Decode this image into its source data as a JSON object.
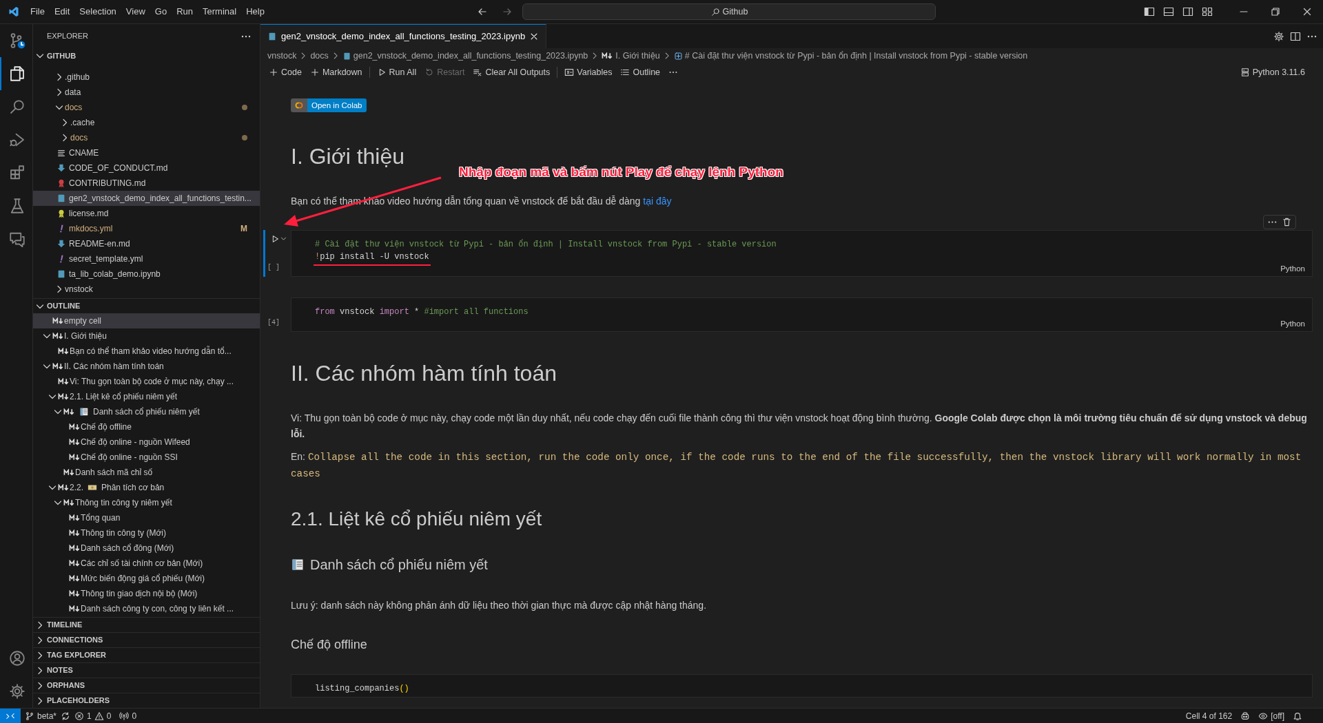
{
  "title_bar": {
    "menu": [
      "File",
      "Edit",
      "Selection",
      "View",
      "Go",
      "Run",
      "Terminal",
      "Help"
    ],
    "search": "Github"
  },
  "activity_bar": [
    {
      "kind": "source-control",
      "selected": false
    },
    {
      "kind": "explorer",
      "selected": true
    },
    {
      "kind": "search",
      "selected": false
    },
    {
      "kind": "run-debug",
      "selected": false
    },
    {
      "kind": "extensions",
      "selected": false
    },
    {
      "kind": "testing",
      "selected": false
    },
    {
      "kind": "chat",
      "selected": false
    }
  ],
  "sidebar": {
    "title": "EXPLORER",
    "folder": {
      "title": "GITHUB",
      "expanded": true
    },
    "tree": [
      {
        "label": ".github",
        "kind": "folder",
        "expanded": false,
        "modified": false,
        "selected": false
      },
      {
        "label": "data",
        "kind": "folder",
        "expanded": false,
        "modified": false,
        "selected": false
      },
      {
        "label": "docs",
        "kind": "folder",
        "expanded": true,
        "modified": true,
        "selected": false,
        "children": [
          {
            "label": ".cache",
            "kind": "folder",
            "expanded": false,
            "modified": false,
            "selected": false
          },
          {
            "label": "docs",
            "kind": "folder",
            "expanded": false,
            "modified": true,
            "selected": false
          },
          {
            "label": "CNAME",
            "kind": "text-file",
            "color": "#cccccc",
            "modified": false,
            "selected": false
          },
          {
            "label": "CODE_OF_CONDUCT.md",
            "kind": "markdown-file",
            "color": "#519aba",
            "modified": false,
            "selected": false
          },
          {
            "label": "CONTRIBUTING.md",
            "kind": "license-file",
            "color": "#cc3e44",
            "modified": false,
            "selected": false
          },
          {
            "label": "gen2_vnstock_demo_index_all_functions_testin...",
            "kind": "notebook-file",
            "color": "#519aba",
            "modified": false,
            "selected": true
          },
          {
            "label": "license.md",
            "kind": "license-file",
            "color": "#cbcb41",
            "modified": false,
            "selected": false
          },
          {
            "label": "mkdocs.yml",
            "kind": "yaml-file",
            "color": "#a074c4",
            "modified": true,
            "badge": "M",
            "selected": false
          },
          {
            "label": "README-en.md",
            "kind": "markdown-file",
            "color": "#519aba",
            "modified": false,
            "selected": false
          },
          {
            "label": "secret_template.yml",
            "kind": "yaml-file",
            "color": "#a074c4",
            "modified": false,
            "selected": false
          },
          {
            "label": "ta_lib_colab_demo.ipynb",
            "kind": "notebook-file",
            "color": "#519aba",
            "modified": false,
            "selected": false
          }
        ]
      },
      {
        "label": "vnstock",
        "kind": "folder",
        "expanded": false,
        "modified": false,
        "selected": false
      }
    ],
    "outline": {
      "title": "OUTLINE",
      "expanded": true,
      "items": [
        {
          "label": "empty cell",
          "selected": true
        },
        {
          "label": "I. Giới thiệu",
          "selected": false,
          "expanded": true,
          "children": [
            {
              "label": "Bạn có thể tham khảo video hướng dẫn tổ...",
              "selected": false
            }
          ]
        },
        {
          "label": "II. Các nhóm hàm tính toán",
          "selected": false,
          "expanded": true,
          "children": [
            {
              "label": "Vi: Thu gọn toàn bộ code ở mục này, chạy ...",
              "selected": false
            },
            {
              "label": "2.1. Liệt kê cổ phiếu niêm yết",
              "selected": false,
              "expanded": true,
              "children": [
                {
                  "label": "Danh sách cổ phiếu niêm yết",
                  "kind": "newspaper",
                  "selected": false,
                  "expanded": true,
                  "children": [
                    {
                      "label": "Chế độ offline",
                      "selected": false
                    },
                    {
                      "label": "Chế độ online - nguồn Wifeed",
                      "selected": false
                    },
                    {
                      "label": "Chế độ online - nguồn SSI",
                      "selected": false
                    }
                  ]
                },
                {
                  "label": "Danh sách mã chỉ số",
                  "selected": false
                }
              ]
            },
            {
              "prefix": "2.2.",
              "kind": "banknote",
              "label": "Phân tích cơ bản",
              "selected": false,
              "expanded": true,
              "children": [
                {
                  "label": "Thông tin công ty niêm yết",
                  "selected": false,
                  "expanded": true,
                  "children": [
                    {
                      "label": "Tổng quan",
                      "selected": false
                    },
                    {
                      "label": "Thông tin công ty (Mới)",
                      "selected": false
                    },
                    {
                      "label": "Danh sách cổ đông (Mới)",
                      "selected": false
                    },
                    {
                      "label": "Các chỉ số tài chính cơ bản (Mới)",
                      "selected": false
                    },
                    {
                      "label": "Mức biến động giá cổ phiếu (Mới)",
                      "selected": false
                    },
                    {
                      "label": "Thông tin giao dịch nội bộ (Mới)",
                      "selected": false
                    },
                    {
                      "label": "Danh sách công ty con, công ty liên kết ...",
                      "selected": false
                    }
                  ]
                }
              ]
            }
          ]
        }
      ]
    },
    "sections": [
      {
        "title": "TIMELINE",
        "expanded": false
      },
      {
        "title": "CONNECTIONS",
        "expanded": false
      },
      {
        "title": "TAG EXPLORER",
        "expanded": false
      },
      {
        "title": "NOTES",
        "expanded": false
      },
      {
        "title": "ORPHANS",
        "expanded": false
      },
      {
        "title": "PLACEHOLDERS",
        "expanded": false
      }
    ]
  },
  "editor": {
    "tabs": [
      {
        "label": "gen2_vnstock_demo_index_all_functions_testing_2023.ipynb",
        "selected": true
      }
    ],
    "breadcrumbs": [
      {
        "label": "vnstock",
        "kind": "folder"
      },
      {
        "label": "docs",
        "kind": "folder"
      },
      {
        "label": "gen2_vnstock_demo_index_all_functions_testing_2023.ipynb",
        "kind": "notebook"
      },
      {
        "label": "I. Giới thiệu",
        "kind": "markdown"
      },
      {
        "label": "# Cài đặt thư viện vnstock từ Pypi - bản ổn định | Install vnstock from Pypi - stable version",
        "kind": "code"
      }
    ],
    "toolbar": [
      [
        {
          "label": "Code",
          "kind": "add",
          "disabled": false
        },
        {
          "label": "Markdown",
          "kind": "add",
          "disabled": false
        }
      ],
      [
        {
          "label": "Run All",
          "kind": "run",
          "disabled": false
        },
        {
          "label": "Restart",
          "kind": "restart",
          "disabled": true
        },
        {
          "label": "Clear All Outputs",
          "kind": "clear",
          "disabled": false
        }
      ],
      [
        {
          "label": "Variables",
          "kind": "variables",
          "disabled": false
        },
        {
          "label": "Outline",
          "kind": "outline",
          "disabled": false
        },
        {
          "kind": "more",
          "disabled": false
        }
      ]
    ],
    "kernel": "Python 3.11.6",
    "cells": [
      {
        "kind": "badge",
        "label": "Open in Colab"
      },
      {
        "kind": "heading1",
        "text": "I. Giới thiệu"
      },
      {
        "kind": "paragraph",
        "text": "Bạn có thể tham khảo video hướng dẫn tổng quan về vnstock để bắt đầu dễ dàng ",
        "link": "tại đây"
      },
      {
        "kind": "code",
        "selected": true,
        "execution": "[ ]",
        "language": "Python",
        "lines": [
          {
            "tokens": [
              {
                "kind": "comment",
                "text": "# Cài đặt thư viện vnstock từ Pypi - bản ổn định | Install vnstock from Pypi - stable version"
              }
            ]
          },
          {
            "annotated": true,
            "tokens": [
              {
                "kind": "bang",
                "text": "!"
              },
              {
                "kind": "plain",
                "text": "pip install -U vnstock"
              }
            ]
          }
        ]
      },
      {
        "kind": "code",
        "selected": false,
        "execution": "[4]",
        "language": "Python",
        "lines": [
          {
            "tokens": [
              {
                "kind": "keyword",
                "text": "from"
              },
              {
                "kind": "plain",
                "text": " vnstock "
              },
              {
                "kind": "keyword",
                "text": "import"
              },
              {
                "kind": "plain",
                "text": " * "
              },
              {
                "kind": "comment",
                "text": "#import all functions"
              }
            ]
          }
        ]
      },
      {
        "kind": "heading1",
        "text": "II. Các nhóm hàm tính toán"
      },
      {
        "kind": "paragraph",
        "text": "Vi: Thu gọn toàn bộ code ở mục này, chạy code một lần duy nhất, nếu code chạy đến cuối file thành công thì thư viện vnstock hoạt động bình thường. **Google Colab được chọn là môi trường tiêu chuẩn để sử dụng vnstock và debug lỗi.**"
      },
      {
        "kind": "paragraph",
        "text": "En: ",
        "code": "Collapse all the code in this section, run the code only once, if the code runs to the end of the file successfully, then the vnstock library will work normally in most cases"
      },
      {
        "kind": "heading2",
        "text": "2.1. Liệt kê cổ phiếu niêm yết"
      },
      {
        "kind": "newspaper-heading3",
        "text": "Danh sách cổ phiếu niêm yết"
      },
      {
        "kind": "paragraph",
        "text": "Lưu ý: danh sách này không phản ánh dữ liệu theo thời gian thực mà được cập nhật hàng tháng."
      },
      {
        "kind": "heading4",
        "text": "Chế độ offline"
      },
      {
        "kind": "code",
        "selected": false,
        "lines": [
          {
            "tokens": [
              {
                "kind": "plain",
                "text": "listing_companies"
              },
              {
                "kind": "bracket",
                "text": "()"
              }
            ]
          }
        ]
      }
    ],
    "annotation": {
      "text": "Nhập đoạn mã và bấm nút Play để chạy lệnh Python"
    }
  },
  "status_bar": {
    "branch": "beta*",
    "errors": "1",
    "warnings": "0",
    "ports": "0",
    "cell_position": "Cell 4 of 162",
    "copilot_status": "[off]"
  }
}
